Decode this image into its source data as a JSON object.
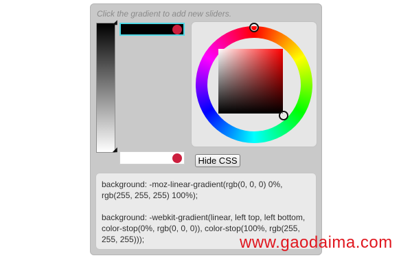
{
  "hint": "Click the gradient to add new sliders.",
  "stops": [
    {
      "color": "#000000",
      "dot_color": "#cc1f3e"
    },
    {
      "color": "#ffffff",
      "dot_color": "#cc1f3e"
    }
  ],
  "buttons": {
    "hide_css": "Hide CSS"
  },
  "css_output": {
    "moz": "background: -moz-linear-gradient(rgb(0, 0, 0) 0%, rgb(255, 255, 255) 100%);",
    "webkit": "background: -webkit-gradient(linear, left top, left bottom, color-stop(0%, rgb(0, 0, 0)), color-stop(100%, rgb(255, 255, 255)));"
  },
  "watermark": "www.gaodaima.com",
  "colors": {
    "selected_outline": "#4fd8e6",
    "stop_dot": "#cc1f3e",
    "watermark": "#e0161e"
  }
}
